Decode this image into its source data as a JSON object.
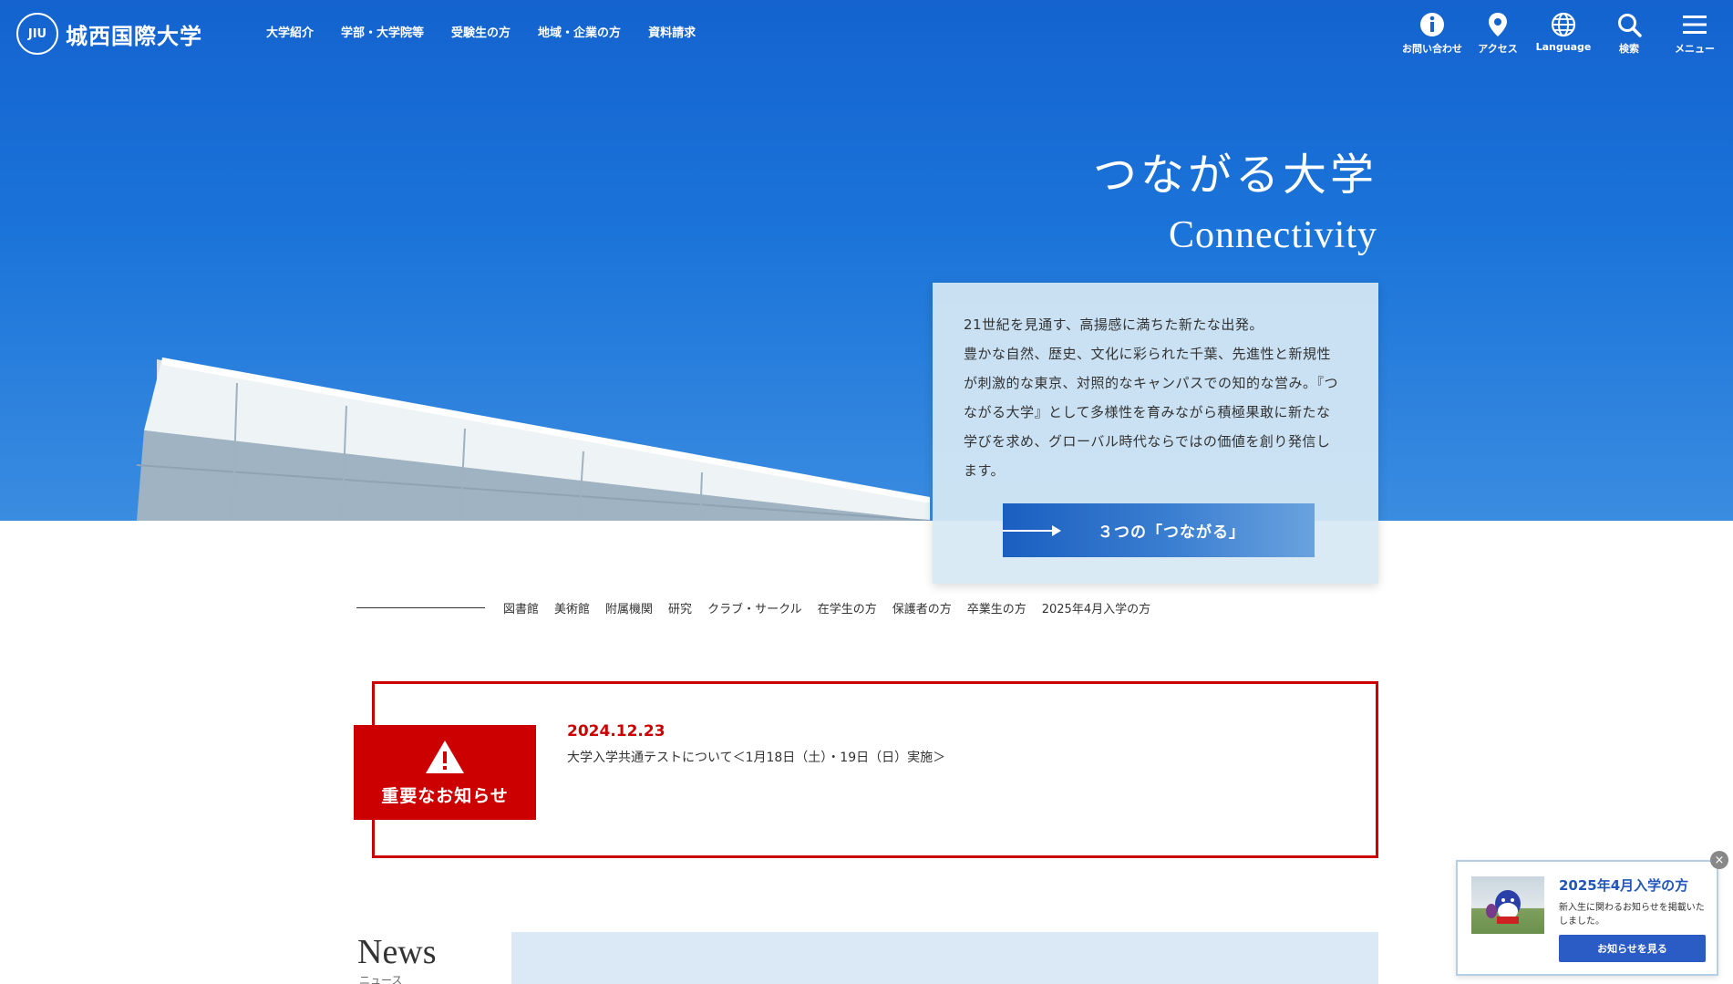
{
  "logo": {
    "seal_text": "JIU",
    "name": "城西国際大学"
  },
  "main_nav": [
    "大学紹介",
    "学部・大学院等",
    "受験生の方",
    "地域・企業の方",
    "資料請求"
  ],
  "util_nav": [
    {
      "icon": "info-icon",
      "label": "お問い合わせ"
    },
    {
      "icon": "map-pin-icon",
      "label": "アクセス"
    },
    {
      "icon": "globe-icon",
      "label": "Language"
    },
    {
      "icon": "search-icon",
      "label": "検索"
    },
    {
      "icon": "menu-icon",
      "label": "メニュー"
    }
  ],
  "hero": {
    "title_jp": "つながる大学",
    "title_en": "Connectivity"
  },
  "intro": {
    "lines": [
      "21世紀を見通す、高揚感に満ちた新たな出発。",
      "豊かな自然、歴史、文化に彩られた千葉、先進性と新規性",
      "が刺激的な東京、対照的なキャンパスでの知的な営み。『つ",
      "ながる大学』として多様性を育みながら積極果敢に新たな",
      "学びを求め、グローバル時代ならではの価値を創り発信し",
      "ます。"
    ],
    "button_label": "３つの「つながる」"
  },
  "sub_nav": [
    "図書館",
    "美術館",
    "附属機関",
    "研究",
    "クラブ・サークル",
    "在学生の方",
    "保護者の方",
    "卒業生の方",
    "2025年4月入学の方"
  ],
  "alert": {
    "tag_label": "重要なお知らせ",
    "date": "2024.12.23",
    "link": "大学入学共通テストについて＜1月18日（土）・19日（日）実施＞"
  },
  "news": {
    "title": "News",
    "subtitle": "ニュース"
  },
  "popup": {
    "title": "2025年4月入学の方",
    "text": "新入生に関わるお知らせを掲載いたしました。",
    "button_label": "お知らせを見る",
    "close_label": "×"
  },
  "colors": {
    "hero_blue": "#1463cf",
    "alert_red": "#cc0000",
    "popup_blue": "#2b5bc4"
  }
}
